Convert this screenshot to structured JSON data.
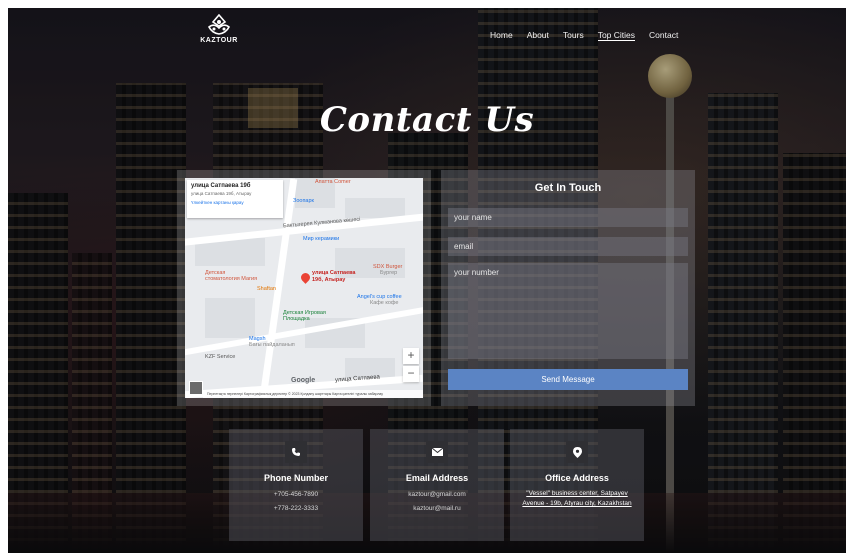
{
  "brand": {
    "name": "KAZTOUR"
  },
  "nav": {
    "items": [
      "Home",
      "About",
      "Tours",
      "Top Cities",
      "Contact"
    ],
    "selected": "Top Cities"
  },
  "hero": {
    "title": "Contact Us"
  },
  "map": {
    "card_title": "улица Сатпаева 19б",
    "card_address": "улица Сатпаева 19б, Атырау",
    "card_link": "Үлкейткен картаны қарау",
    "labels": {
      "zoo_top": "Апатта Соmer",
      "zoo_sub": "Зоопарк",
      "street1": "Бактыгерея Кулманова көшесі",
      "ceramics": "Мир керамики",
      "dental1": "Детская",
      "dental2": "стоматология Магия",
      "shaftan": "Shaftan",
      "target1": "улица Сатпаева",
      "target2": "19б, Атырау",
      "sdx1": "SDX Burger",
      "sdx2": "Бургер",
      "angel1": "Angel's cup coffee",
      "angel2": "Кафе кофе",
      "playground1": "Детская Игровая",
      "playground2": "Площадка",
      "magsh1": "Magsh",
      "magsh2": "Бағы пайдаланып",
      "kzf": "KZF Service",
      "street2": "улица Сатпаева"
    },
    "google_label": "Google",
    "attribution": "Пернетақта пернелері   Картографиялық деректер © 2023   Қолдану шарттары   Карта қателігі туралы хабарлау",
    "zoom_in": "+",
    "zoom_out": "−"
  },
  "form": {
    "title": "Get In Touch",
    "name_placeholder": "your name",
    "email_placeholder": "email",
    "number_placeholder": "your number",
    "submit_label": "Send Message"
  },
  "contact": {
    "phone": {
      "title": "Phone Number",
      "lines": [
        "+705-456-7890",
        "+778-222-3333"
      ]
    },
    "email": {
      "title": "Email Address",
      "lines": [
        "kaztour@gmail.com",
        "kaztour@mail.ru"
      ]
    },
    "office": {
      "title": "Office Address",
      "address": "\"Vessel\" business center, Satpayev Avenue - 19b, Atyrau city, Kazakhstan"
    }
  },
  "colors": {
    "button": "#5b84c4",
    "map_pin": "#ea4335",
    "accent_blue": "#1a73e8"
  }
}
